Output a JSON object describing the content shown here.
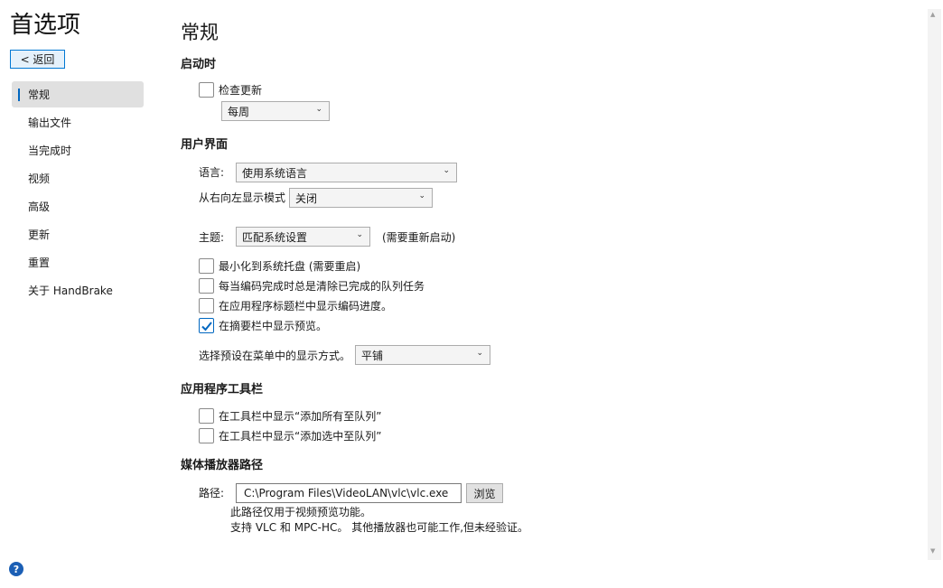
{
  "window": {
    "title": "首选项",
    "back_label": "< 返回"
  },
  "nav": {
    "items": [
      {
        "label": "常规",
        "selected": true
      },
      {
        "label": "输出文件",
        "selected": false
      },
      {
        "label": "当完成时",
        "selected": false
      },
      {
        "label": "视频",
        "selected": false
      },
      {
        "label": "高级",
        "selected": false
      },
      {
        "label": "更新",
        "selected": false
      },
      {
        "label": "重置",
        "selected": false
      },
      {
        "label": "关于 HandBrake",
        "selected": false
      }
    ]
  },
  "main": {
    "title": "常规",
    "startup": {
      "title": "启动时",
      "check_updates": {
        "label": "检查更新",
        "checked": false
      },
      "update_frequency": "每周"
    },
    "ui": {
      "title": "用户界面",
      "language_label": "语言:",
      "language_value": "使用系统语言",
      "rtl_label": "从右向左显示模式",
      "rtl_value": "关闭",
      "theme_label": "主题:",
      "theme_value": "匹配系统设置",
      "theme_note": "(需要重新启动)",
      "options": [
        {
          "label": "最小化到系统托盘 (需要重启)",
          "checked": false
        },
        {
          "label": "每当编码完成时总是清除已完成的队列任务",
          "checked": false
        },
        {
          "label": "在应用程序标题栏中显示编码进度。",
          "checked": false
        },
        {
          "label": "在摘要栏中显示预览。",
          "checked": true
        }
      ],
      "preset_display_label": "选择预设在菜单中的显示方式。",
      "preset_display_value": "平铺"
    },
    "toolbar": {
      "title": "应用程序工具栏",
      "options": [
        {
          "label": "在工具栏中显示“添加所有至队列”",
          "checked": false
        },
        {
          "label": "在工具栏中显示“添加选中至队列”",
          "checked": false
        }
      ]
    },
    "media_player": {
      "title": "媒体播放器路径",
      "path_label": "路径:",
      "path_value": "C:\\Program Files\\VideoLAN\\vlc\\vlc.exe",
      "browse_label": "浏览",
      "note_1": "此路径仅用于视频预览功能。",
      "note_2": "支持 VLC 和 MPC-HC。 其他播放器也可能工作,但未经验证。"
    }
  },
  "icons": {
    "help": "help-icon",
    "check": "checkmark-icon",
    "dropdown": "chevron-down-icon"
  },
  "colors": {
    "accent": "#0067c0",
    "help_icon": "#1b5fb5"
  }
}
